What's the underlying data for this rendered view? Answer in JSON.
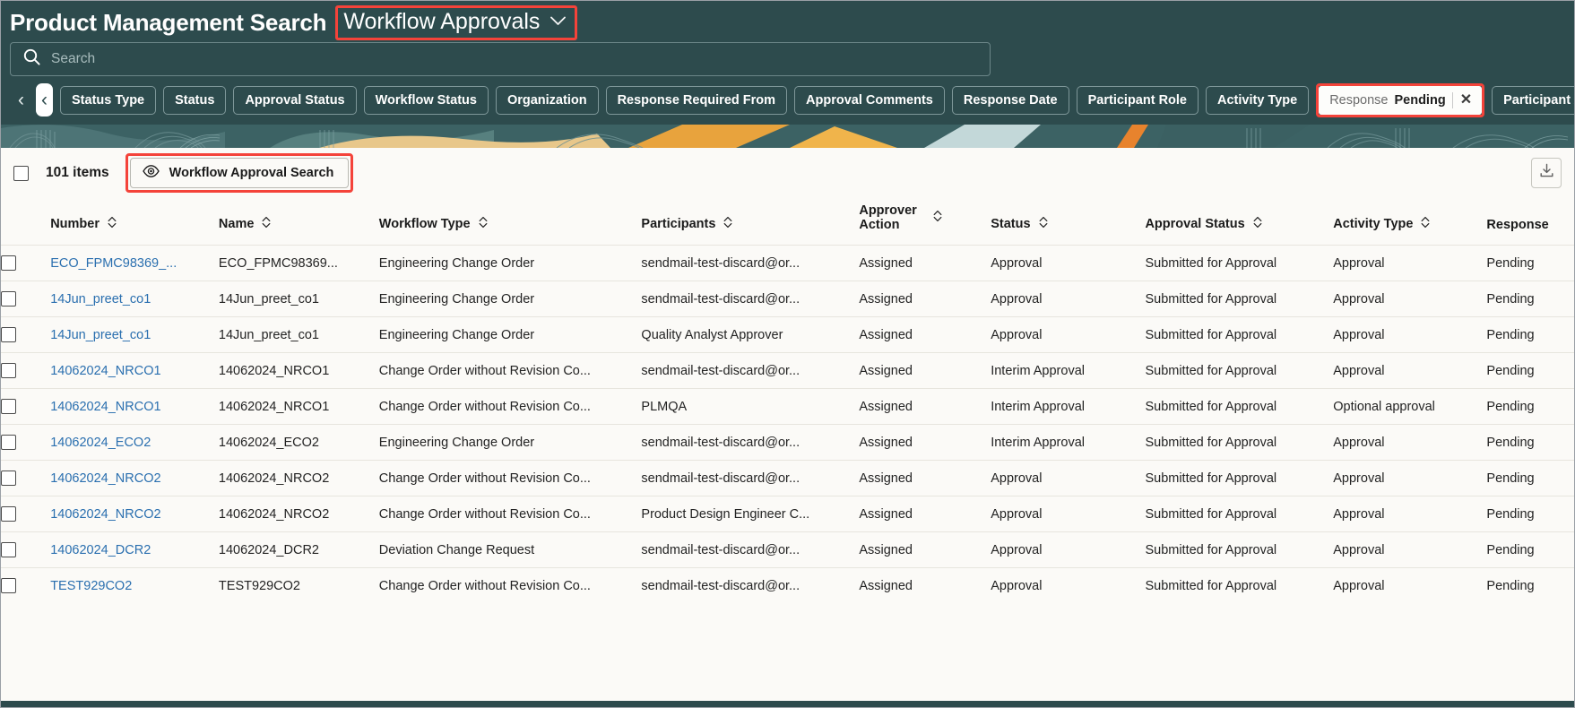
{
  "header": {
    "app_title": "Product Management Search",
    "context_label": "Workflow Approvals",
    "context_chevron": "chevron-down"
  },
  "search": {
    "value": "",
    "placeholder": "Search"
  },
  "filters": {
    "prev_label": "‹",
    "prev_focused_label": "‹",
    "next_label": "›",
    "chips": [
      "Status Type",
      "Status",
      "Approval Status",
      "Workflow Status",
      "Organization",
      "Response Required From",
      "Approval Comments",
      "Response Date",
      "Participant Role",
      "Activity Type"
    ],
    "active_chip": {
      "label": "Response",
      "value": "Pending",
      "remove_label": "✕"
    },
    "chips_after": [
      "Participant Assigned Date"
    ]
  },
  "toolbar": {
    "select_all_checked": false,
    "items_count": "101 items",
    "workflow_approval_search_label": "Workflow Approval Search",
    "eye_icon": "eye-icon",
    "download_icon": "download-icon"
  },
  "table": {
    "columns": [
      {
        "key": "number",
        "label": "Number",
        "sortable": true
      },
      {
        "key": "name",
        "label": "Name",
        "sortable": true
      },
      {
        "key": "workflow_type",
        "label": "Workflow Type",
        "sortable": true
      },
      {
        "key": "participants",
        "label": "Participants",
        "sortable": true
      },
      {
        "key": "approver_action",
        "label": "Approver Action",
        "sortable": true
      },
      {
        "key": "status",
        "label": "Status",
        "sortable": true
      },
      {
        "key": "approval_status",
        "label": "Approval Status",
        "sortable": true
      },
      {
        "key": "activity_type",
        "label": "Activity Type",
        "sortable": true
      },
      {
        "key": "response",
        "label": "Response",
        "sortable": false
      }
    ],
    "rows": [
      {
        "number": "ECO_FPMC98369_...",
        "name": "ECO_FPMC98369...",
        "workflow_type": "Engineering Change Order",
        "participants": "sendmail-test-discard@or...",
        "approver_action": "Assigned",
        "status": "Approval",
        "approval_status": "Submitted for Approval",
        "activity_type": "Approval",
        "response": "Pending"
      },
      {
        "number": "14Jun_preet_co1",
        "name": "14Jun_preet_co1",
        "workflow_type": "Engineering Change Order",
        "participants": "sendmail-test-discard@or...",
        "approver_action": "Assigned",
        "status": "Approval",
        "approval_status": "Submitted for Approval",
        "activity_type": "Approval",
        "response": "Pending"
      },
      {
        "number": "14Jun_preet_co1",
        "name": "14Jun_preet_co1",
        "workflow_type": "Engineering Change Order",
        "participants": "Quality Analyst Approver",
        "approver_action": "Assigned",
        "status": "Approval",
        "approval_status": "Submitted for Approval",
        "activity_type": "Approval",
        "response": "Pending"
      },
      {
        "number": "14062024_NRCO1",
        "name": "14062024_NRCO1",
        "workflow_type": "Change Order without Revision Co...",
        "participants": "sendmail-test-discard@or...",
        "approver_action": "Assigned",
        "status": "Interim Approval",
        "approval_status": "Submitted for Approval",
        "activity_type": "Approval",
        "response": "Pending"
      },
      {
        "number": "14062024_NRCO1",
        "name": "14062024_NRCO1",
        "workflow_type": "Change Order without Revision Co...",
        "participants": "PLMQA",
        "approver_action": "Assigned",
        "status": "Interim Approval",
        "approval_status": "Submitted for Approval",
        "activity_type": "Optional approval",
        "response": "Pending"
      },
      {
        "number": "14062024_ECO2",
        "name": "14062024_ECO2",
        "workflow_type": "Engineering Change Order",
        "participants": "sendmail-test-discard@or...",
        "approver_action": "Assigned",
        "status": "Interim Approval",
        "approval_status": "Submitted for Approval",
        "activity_type": "Approval",
        "response": "Pending"
      },
      {
        "number": "14062024_NRCO2",
        "name": "14062024_NRCO2",
        "workflow_type": "Change Order without Revision Co...",
        "participants": "sendmail-test-discard@or...",
        "approver_action": "Assigned",
        "status": "Approval",
        "approval_status": "Submitted for Approval",
        "activity_type": "Approval",
        "response": "Pending"
      },
      {
        "number": "14062024_NRCO2",
        "name": "14062024_NRCO2",
        "workflow_type": "Change Order without Revision Co...",
        "participants": "Product Design Engineer C...",
        "approver_action": "Assigned",
        "status": "Approval",
        "approval_status": "Submitted for Approval",
        "activity_type": "Approval",
        "response": "Pending"
      },
      {
        "number": "14062024_DCR2",
        "name": "14062024_DCR2",
        "workflow_type": "Deviation Change Request",
        "participants": "sendmail-test-discard@or...",
        "approver_action": "Assigned",
        "status": "Approval",
        "approval_status": "Submitted for Approval",
        "activity_type": "Approval",
        "response": "Pending"
      },
      {
        "number": "TEST929CO2",
        "name": "TEST929CO2",
        "workflow_type": "Change Order without Revision Co...",
        "participants": "sendmail-test-discard@or...",
        "approver_action": "Assigned",
        "status": "Approval",
        "approval_status": "Submitted for Approval",
        "activity_type": "Approval",
        "response": "Pending"
      }
    ]
  },
  "colors": {
    "header_bg": "#2d4b4d",
    "content_bg": "#fbfaf7",
    "link": "#2a6faf",
    "highlight_outline": "#f4433a",
    "banner_accent": "#e8a33d"
  }
}
